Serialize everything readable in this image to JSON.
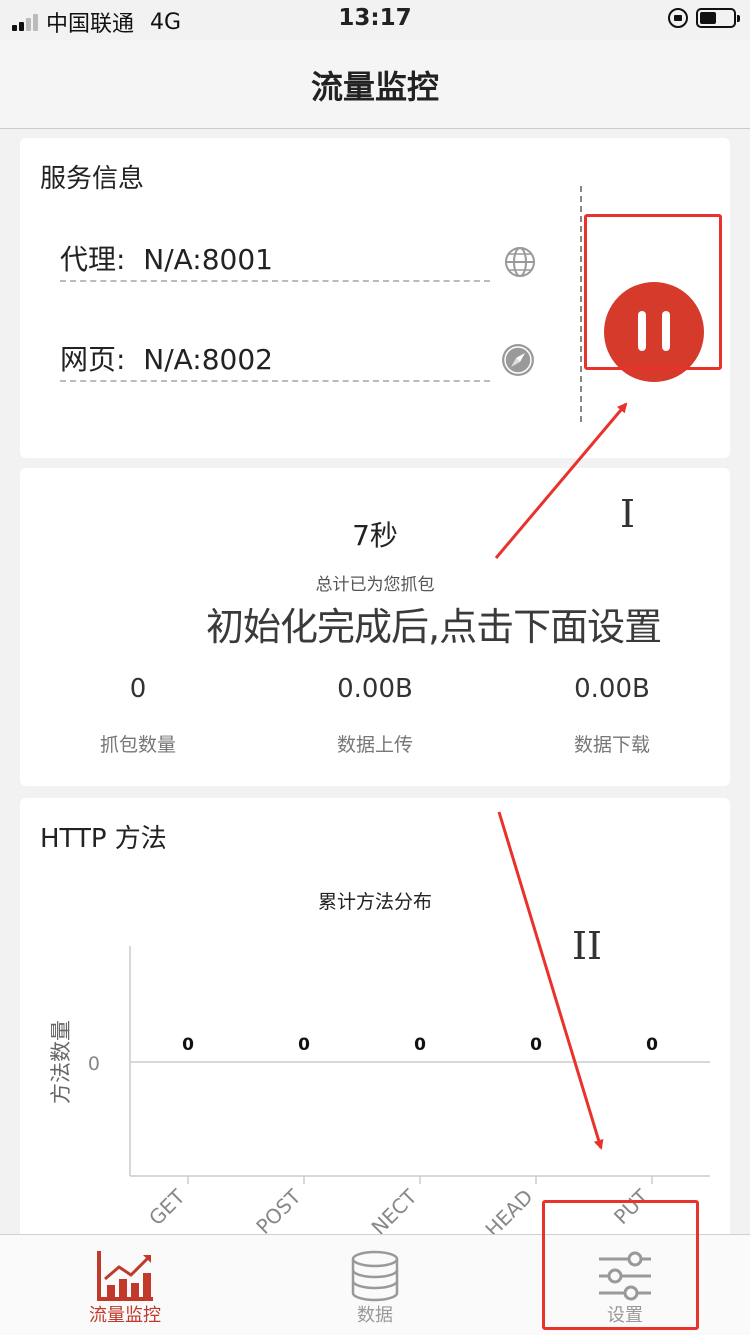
{
  "status_bar": {
    "carrier": "中国联通",
    "network": "4G",
    "time": "13:17"
  },
  "nav": {
    "title": "流量监控"
  },
  "service": {
    "title": "服务信息",
    "proxy": {
      "label": "代理:",
      "value": "N/A:8001",
      "icon": "globe-icon"
    },
    "web": {
      "label": "网页:",
      "value": "N/A:8002",
      "icon": "compass-icon"
    },
    "toggle": {
      "state": "running",
      "icon": "pause-icon",
      "color": "#d63a2a"
    }
  },
  "capture": {
    "elapsed": "7秒",
    "elapsed_label": "总计已为您抓包",
    "stats": [
      {
        "value": "0",
        "label": "抓包数量"
      },
      {
        "value": "0.00B",
        "label": "数据上传"
      },
      {
        "value": "0.00B",
        "label": "数据下载"
      }
    ]
  },
  "annotations": {
    "instruction": "初始化完成后,点击下面设置",
    "step1": "I",
    "step2": "II",
    "color": "#e8322b"
  },
  "http_methods": {
    "title": "HTTP 方法",
    "chart_data": {
      "type": "bar",
      "title": "累计方法分布",
      "ylabel": "方法数量",
      "xlabel": "",
      "categories": [
        "GET",
        "POST",
        "CONNECT",
        "HEAD",
        "PUT"
      ],
      "visible_tick_labels": [
        "GET",
        "POST",
        "NECT",
        "HEAD",
        "PUT"
      ],
      "values": [
        0,
        0,
        0,
        0,
        0
      ],
      "y_ticks": [
        "0"
      ],
      "grid": true
    }
  },
  "tab_bar": {
    "items": [
      {
        "label": "流量监控",
        "icon": "chart-trend-icon",
        "active": true
      },
      {
        "label": "数据",
        "icon": "database-icon",
        "active": false
      },
      {
        "label": "设置",
        "icon": "sliders-icon",
        "active": false
      }
    ],
    "active_color": "#c0392b",
    "inactive_color": "#999999"
  }
}
